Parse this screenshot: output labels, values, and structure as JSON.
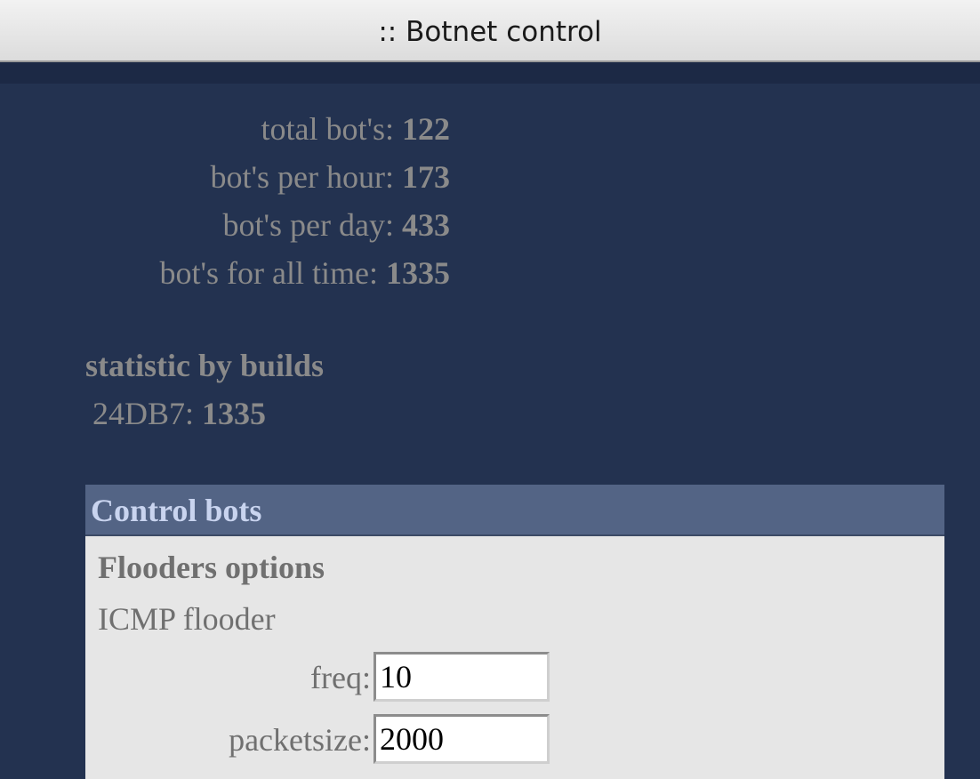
{
  "window": {
    "title": ":: Botnet control"
  },
  "stats": [
    {
      "label": "total bot's:",
      "value": "122"
    },
    {
      "label": "bot's per hour:",
      "value": "173"
    },
    {
      "label": "bot's per day:",
      "value": "433"
    },
    {
      "label": "bot's for all time:",
      "value": "1335"
    }
  ],
  "builds": {
    "title": "statistic by builds",
    "items": [
      {
        "label": "24DB7:",
        "value": "1335"
      }
    ]
  },
  "control": {
    "header": "Control bots",
    "subtitle": "Flooders options",
    "flooder": "ICMP flooder",
    "fields": [
      {
        "label": "freq:",
        "value": "10"
      },
      {
        "label": "packetsize:",
        "value": "2000"
      }
    ]
  },
  "colors": {
    "background": "#233250",
    "panel_header": "#536485",
    "panel_body": "#e6e6e6",
    "muted_text": "#8a8a8a"
  }
}
